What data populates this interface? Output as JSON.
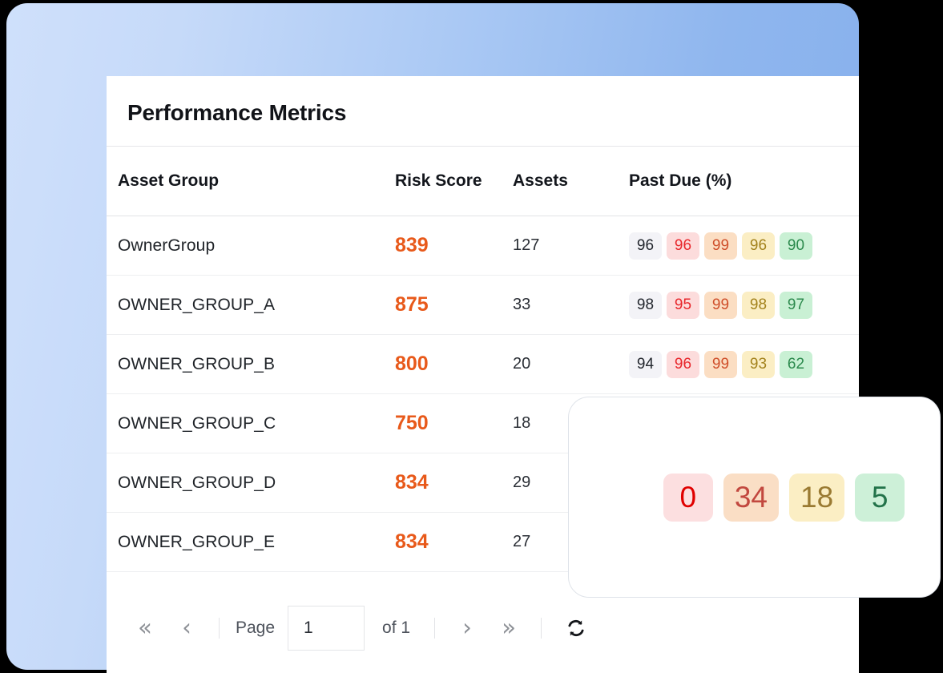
{
  "backdrop": {
    "gradient_from": "#cfe0fb",
    "gradient_to": "#85afec"
  },
  "card": {
    "title": "Performance Metrics",
    "columns": [
      "Asset Group",
      "Risk Score",
      "Assets",
      "Past Due (%)"
    ],
    "rows": [
      {
        "group": "OwnerGroup",
        "risk": "839",
        "assets": "127",
        "past_due": [
          "96",
          "96",
          "99",
          "96",
          "90"
        ]
      },
      {
        "group": "OWNER_GROUP_A",
        "risk": "875",
        "assets": "33",
        "past_due": [
          "98",
          "95",
          "99",
          "98",
          "97"
        ]
      },
      {
        "group": "OWNER_GROUP_B",
        "risk": "800",
        "assets": "20",
        "past_due": [
          "94",
          "96",
          "99",
          "93",
          "62"
        ]
      },
      {
        "group": "OWNER_GROUP_C",
        "risk": "750",
        "assets": "18",
        "past_due": []
      },
      {
        "group": "OWNER_GROUP_D",
        "risk": "834",
        "assets": "29",
        "past_due": []
      },
      {
        "group": "OWNER_GROUP_E",
        "risk": "834",
        "assets": "27",
        "past_due": []
      }
    ]
  },
  "pagination": {
    "first_icon": "«",
    "prev_icon": "‹",
    "page_label": "Page",
    "page_value": "1",
    "page_placeholder": "1",
    "of_label": "of 1",
    "next_icon": "›",
    "last_icon": "»",
    "refresh_icon": "refresh-icon"
  },
  "overlay": {
    "badges": [
      "0",
      "34",
      "18",
      "5"
    ]
  },
  "colors": {
    "risk_score": "#e8591a",
    "badge_neutral_bg": "#f3f3f7",
    "badge_red_bg": "#fcdcdc",
    "badge_orange_bg": "#fbdec3",
    "badge_yellow_bg": "#fbeec4",
    "badge_green_bg": "#c9f0d4"
  }
}
